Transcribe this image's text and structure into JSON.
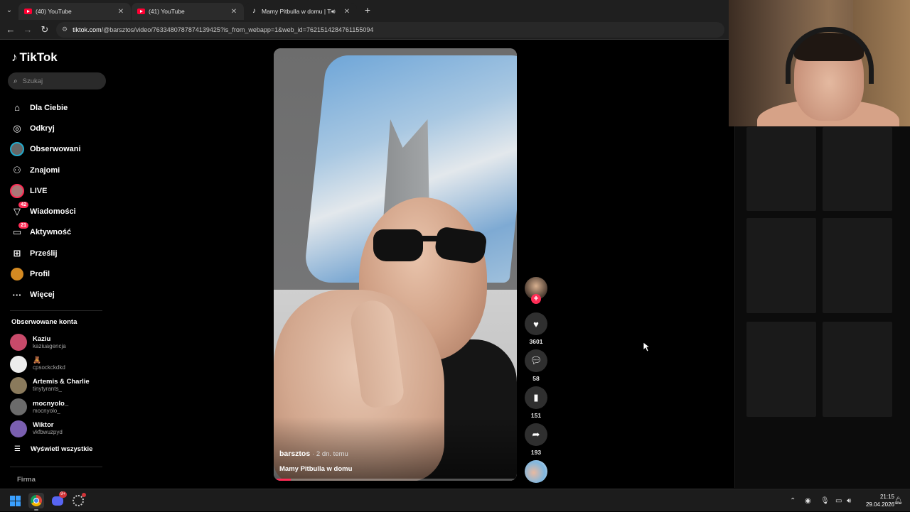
{
  "browser": {
    "tabs": [
      {
        "title": "(40) YouTube",
        "favicon": "youtube-icon",
        "state": "inactive"
      },
      {
        "title": "(41) YouTube",
        "favicon": "youtube-icon",
        "state": "inactive"
      },
      {
        "title": "Mamy Pitbulla w domu | Ti",
        "favicon": "tiktok-icon",
        "state": "active",
        "audio": true
      }
    ],
    "url_host": "tiktok.com",
    "url_path": "/@barsztos/video/7633480787874139425?is_from_webapp=1&web_id=7621514284761155094"
  },
  "sidebar": {
    "logo": "TikTok",
    "search_placeholder": "Szukaj",
    "nav": [
      {
        "label": "Dla Ciebie",
        "icon": "home-icon"
      },
      {
        "label": "Odkryj",
        "icon": "compass-icon"
      },
      {
        "label": "Obserwowani",
        "icon": "following-avatar-icon"
      },
      {
        "label": "Znajomi",
        "icon": "friends-icon"
      },
      {
        "label": "LIVE",
        "icon": "live-avatar-icon"
      },
      {
        "label": "Wiadomości",
        "icon": "messages-icon",
        "badge": "42"
      },
      {
        "label": "Aktywność",
        "icon": "activity-icon",
        "badge": "21"
      },
      {
        "label": "Prześlij",
        "icon": "upload-icon"
      },
      {
        "label": "Profil",
        "icon": "profile-avatar-icon"
      },
      {
        "label": "Więcej",
        "icon": "more-icon"
      }
    ],
    "following_heading": "Obserwowane konta",
    "following": [
      {
        "name": "Kaziu",
        "username": "kaziuagencja",
        "color": "#c84a6a"
      },
      {
        "name": "🧸",
        "username": "cpsockckdkd",
        "color": "#ececec"
      },
      {
        "name": "Artemis & Charlie",
        "username": "tinytyrants_",
        "color": "#8a7a5c"
      },
      {
        "name": "mocnyolo_",
        "username": "mocnyolo_",
        "color": "#6b6b6b"
      },
      {
        "name": "Wiktor",
        "username": "vkfbwuzpyd",
        "color": "#7a5fb0"
      }
    ],
    "show_all": "Wyświetl wszystkie",
    "footer": "Firma"
  },
  "video": {
    "author": "barsztos",
    "posted": "· 2 dn. temu",
    "caption": "Mamy Pitbulla w domu",
    "progress": 0.07
  },
  "actions": {
    "likes": "3601",
    "comments": "58",
    "saves": "151",
    "shares": "193"
  },
  "taskbar": {
    "discord_badge": "9+",
    "time": "21:15",
    "date": "29.04.2026"
  },
  "colors": {
    "accent": "#fe2c55",
    "background": "#000000",
    "sidebar_text": "#ffffff"
  }
}
